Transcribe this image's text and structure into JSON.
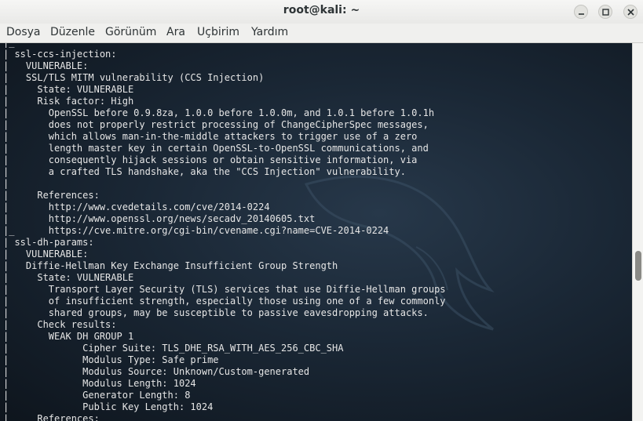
{
  "window": {
    "title": "root@kali: ~"
  },
  "menu": [
    "Dosya",
    "Düzenle",
    "Görünüm",
    "Ara",
    "Uçbirim",
    "Yardım"
  ],
  "terminal": {
    "lines": [
      "|_",
      "| ssl-ccs-injection:",
      "|   VULNERABLE:",
      "|   SSL/TLS MITM vulnerability (CCS Injection)",
      "|     State: VULNERABLE",
      "|     Risk factor: High",
      "|       OpenSSL before 0.9.8za, 1.0.0 before 1.0.0m, and 1.0.1 before 1.0.1h",
      "|       does not properly restrict processing of ChangeCipherSpec messages,",
      "|       which allows man-in-the-middle attackers to trigger use of a zero",
      "|       length master key in certain OpenSSL-to-OpenSSL communications, and",
      "|       consequently hijack sessions or obtain sensitive information, via",
      "|       a crafted TLS handshake, aka the \"CCS Injection\" vulnerability.",
      "|",
      "|     References:",
      "|       http://www.cvedetails.com/cve/2014-0224",
      "|       http://www.openssl.org/news/secadv_20140605.txt",
      "|_      https://cve.mitre.org/cgi-bin/cvename.cgi?name=CVE-2014-0224",
      "| ssl-dh-params:",
      "|   VULNERABLE:",
      "|   Diffie-Hellman Key Exchange Insufficient Group Strength",
      "|     State: VULNERABLE",
      "|       Transport Layer Security (TLS) services that use Diffie-Hellman groups",
      "|       of insufficient strength, especially those using one of a few commonly",
      "|       shared groups, may be susceptible to passive eavesdropping attacks.",
      "|     Check results:",
      "|       WEAK DH GROUP 1",
      "|             Cipher Suite: TLS_DHE_RSA_WITH_AES_256_CBC_SHA",
      "|             Modulus Type: Safe prime",
      "|             Modulus Source: Unknown/Custom-generated",
      "|             Modulus Length: 1024",
      "|             Generator Length: 8",
      "|             Public Key Length: 1024",
      "|     References:"
    ]
  },
  "colors": {
    "terminal_bg": "#1b2a38",
    "terminal_text": "#e6e6e6",
    "titlebar_bg": "#efefed"
  }
}
